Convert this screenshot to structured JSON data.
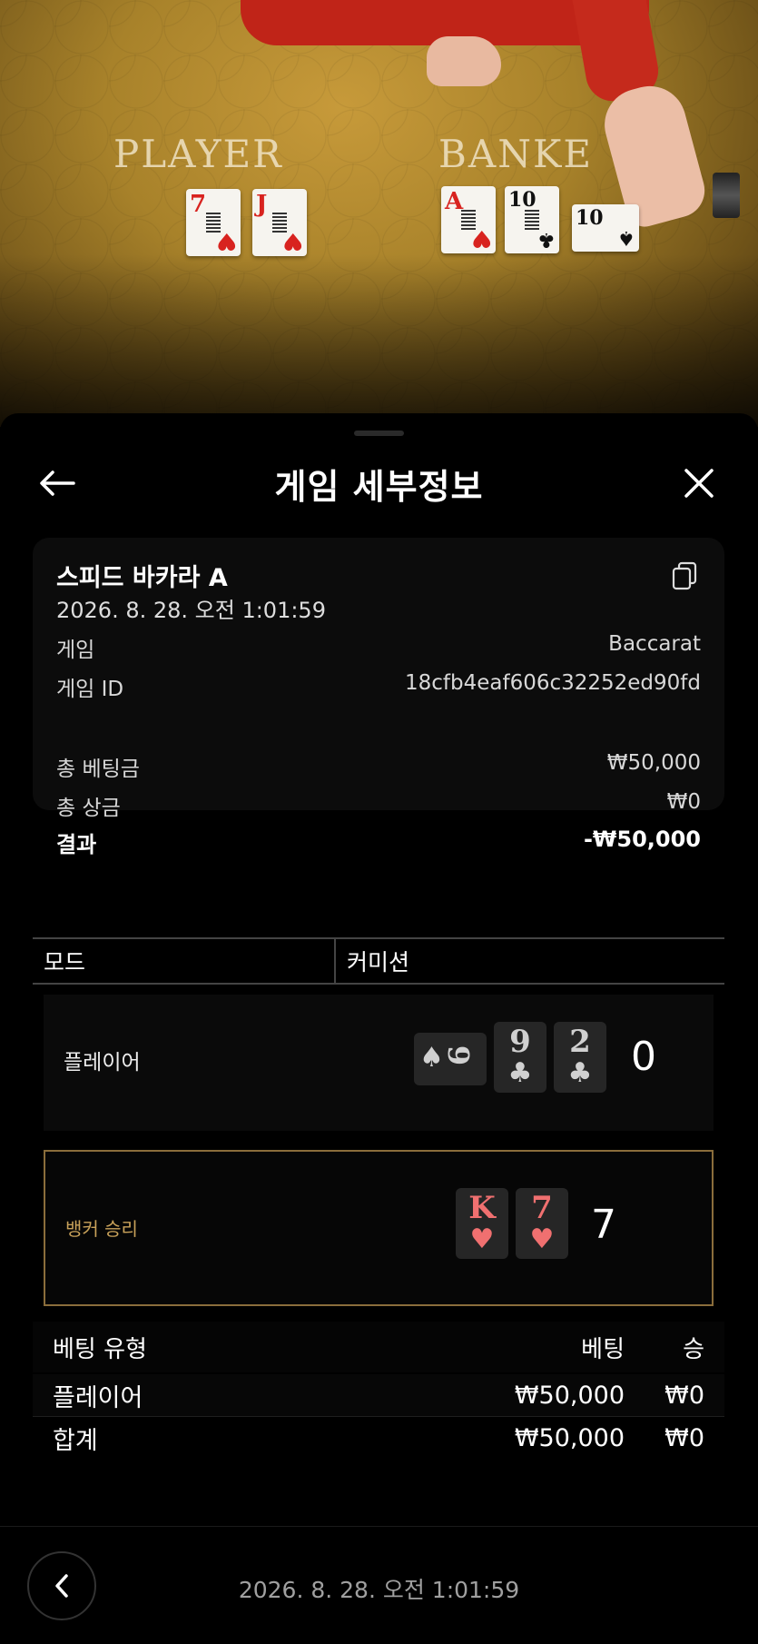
{
  "video": {
    "player_word": "PLAYER",
    "banker_word": "BANKE",
    "player_cards": [
      {
        "rank": "7",
        "suit": "♥",
        "color": "red"
      },
      {
        "rank": "J",
        "suit": "♥",
        "color": "red"
      }
    ],
    "banker_cards": [
      {
        "rank": "A",
        "suit": "♥",
        "color": "red"
      },
      {
        "rank": "10",
        "suit": "♣",
        "color": "blk"
      },
      {
        "rank": "10",
        "suit": "♠",
        "color": "blk"
      }
    ]
  },
  "sheet": {
    "title": "게임 세부정보",
    "back_icon": "arrow-left-icon",
    "close_icon": "close-icon"
  },
  "summary": {
    "game_name": "스피드 바카라 A",
    "datetime": "2026. 8. 28. 오전 1:01:59",
    "game_label": "게임",
    "game_value": "Baccarat",
    "game_id_label": "게임 ID",
    "game_id_value": "18cfb4eaf606c32252ed90fd",
    "total_bet_label": "총 베팅금",
    "total_bet_value": "₩50,000",
    "total_win_label": "총 상금",
    "total_win_value": "₩0",
    "result_label": "결과",
    "result_value": "-₩50,000"
  },
  "mode": {
    "col1": "모드",
    "col2": "커미션"
  },
  "player_hand": {
    "label": "플레이어",
    "cards": [
      {
        "rank": "9",
        "suit": "♠",
        "style": "bw",
        "sideways": true
      },
      {
        "rank": "9",
        "suit": "♣",
        "style": "bw"
      },
      {
        "rank": "2",
        "suit": "♣",
        "style": "bw"
      }
    ],
    "score": "0"
  },
  "banker_hand": {
    "label": "뱅커 승리",
    "cards": [
      {
        "rank": "K",
        "suit": "♥",
        "style": "red"
      },
      {
        "rank": "7",
        "suit": "♥",
        "style": "red"
      }
    ],
    "score": "7"
  },
  "bets": {
    "headers": {
      "type": "베팅 유형",
      "bet": "베팅",
      "win": "승"
    },
    "rows": [
      {
        "type": "플레이어",
        "bet": "₩50,000",
        "win": "₩0"
      }
    ],
    "total": {
      "type": "합계",
      "bet": "₩50,000",
      "win": "₩0"
    }
  },
  "footer": {
    "datetime": "2026. 8. 28. 오전 1:01:59"
  }
}
